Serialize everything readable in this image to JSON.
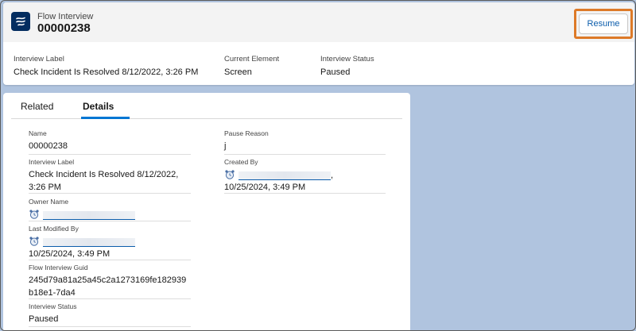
{
  "header": {
    "object_type": "Flow Interview",
    "record_name": "00000238",
    "resume_label": "Resume",
    "icon": "flow-icon"
  },
  "highlights": [
    {
      "label": "Interview Label",
      "value": "Check Incident Is Resolved 8/12/2022, 3:26 PM"
    },
    {
      "label": "Current Element",
      "value": "Screen"
    },
    {
      "label": "Interview Status",
      "value": "Paused"
    }
  ],
  "tabs": [
    {
      "label": "Related",
      "active": false
    },
    {
      "label": "Details",
      "active": true
    }
  ],
  "details": {
    "name": {
      "label": "Name",
      "value": "00000238"
    },
    "interview_label": {
      "label": "Interview Label",
      "value": "Check Incident Is Resolved 8/12/2022, 3:26 PM"
    },
    "owner_name": {
      "label": "Owner Name",
      "icon": "user-avatar-icon"
    },
    "last_modified_by": {
      "label": "Last Modified By",
      "date": "10/25/2024, 3:49 PM",
      "icon": "user-avatar-icon"
    },
    "flow_interview_guid": {
      "label": "Flow Interview Guid",
      "value": "245d79a81a25a45c2a1273169fe182939b18e1-7da4"
    },
    "interview_status": {
      "label": "Interview Status",
      "value": "Paused"
    },
    "pause_reason": {
      "label": "Pause Reason",
      "value": "j"
    },
    "created_by": {
      "label": "Created By",
      "date": "10/25/2024, 3:49 PM",
      "separator": ",",
      "icon": "user-avatar-icon"
    }
  },
  "colors": {
    "background": "#b0c4df",
    "brand_blue": "#0176d3",
    "link_blue": "#0b5cab",
    "highlight_orange": "#dd7a28",
    "icon_navy": "#032d60"
  }
}
